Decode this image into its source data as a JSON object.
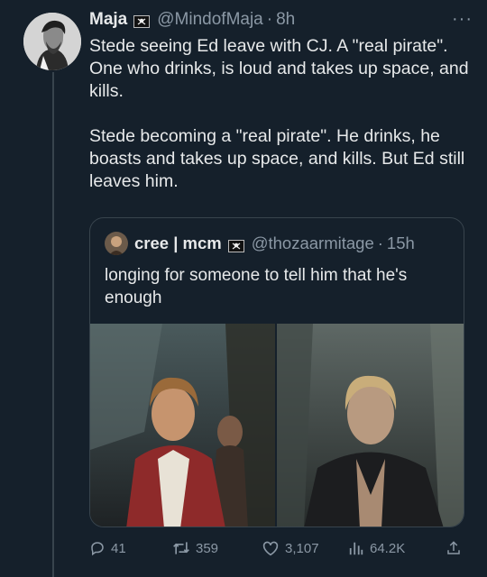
{
  "tweet": {
    "display_name": "Maja",
    "handle": "@MindofMaja",
    "separator": "·",
    "time": "8h",
    "more": "···",
    "text": "Stede seeing Ed leave with CJ. A \"real pirate\". One who drinks, is loud and takes up space, and kills.\n\nStede becoming a \"real pirate\". He drinks, he boasts and takes up space, and kills. But Ed still leaves him."
  },
  "quote": {
    "display_name": "cree | mcm",
    "handle": "@thozaarmitage",
    "separator": "·",
    "time": "15h",
    "text": "longing for someone to tell him that he's enough"
  },
  "actions": {
    "replies": "41",
    "retweets": "359",
    "likes": "3,107",
    "views": "64.2K"
  },
  "icons": [
    "pirate-flag-icon",
    "more-icon",
    "reply-icon",
    "retweet-icon",
    "like-icon",
    "views-icon",
    "share-icon"
  ],
  "colors": {
    "background": "#15202b",
    "text": "#e7e9ea",
    "muted": "#8b98a5",
    "border": "#38444d"
  }
}
